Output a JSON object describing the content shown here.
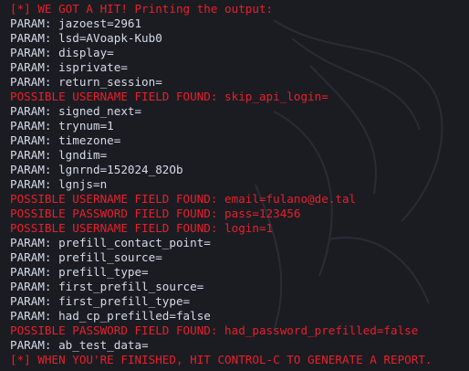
{
  "colors": {
    "background": "#1b1c22",
    "normal_text": "#d5dbe8",
    "alert_text": "#e8202a"
  },
  "terminal": {
    "lines": [
      {
        "kind": "status",
        "text": "[*] WE GOT A HIT! Printing the output:"
      },
      {
        "kind": "param",
        "text": "PARAM: jazoest=2961"
      },
      {
        "kind": "param",
        "text": "PARAM: lsd=AVoapk-Kub0"
      },
      {
        "kind": "param",
        "text": "PARAM: display="
      },
      {
        "kind": "param",
        "text": "PARAM: isprivate="
      },
      {
        "kind": "param",
        "text": "PARAM: return_session="
      },
      {
        "kind": "found",
        "text": "POSSIBLE USERNAME FIELD FOUND: skip_api_login="
      },
      {
        "kind": "param",
        "text": "PARAM: signed_next="
      },
      {
        "kind": "param",
        "text": "PARAM: trynum=1"
      },
      {
        "kind": "param",
        "text": "PARAM: timezone="
      },
      {
        "kind": "param",
        "text": "PARAM: lgndim="
      },
      {
        "kind": "param",
        "text": "PARAM: lgnrnd=152024_82Ob"
      },
      {
        "kind": "param",
        "text": "PARAM: lgnjs=n"
      },
      {
        "kind": "found",
        "text": "POSSIBLE USERNAME FIELD FOUND: email=fulano@de.tal"
      },
      {
        "kind": "found",
        "text": "POSSIBLE PASSWORD FIELD FOUND: pass=123456"
      },
      {
        "kind": "found",
        "text": "POSSIBLE USERNAME FIELD FOUND: login=1"
      },
      {
        "kind": "param",
        "text": "PARAM: prefill_contact_point="
      },
      {
        "kind": "param",
        "text": "PARAM: prefill_source="
      },
      {
        "kind": "param",
        "text": "PARAM: prefill_type="
      },
      {
        "kind": "param",
        "text": "PARAM: first_prefill_source="
      },
      {
        "kind": "param",
        "text": "PARAM: first_prefill_type="
      },
      {
        "kind": "param",
        "text": "PARAM: had_cp_prefilled=false"
      },
      {
        "kind": "found",
        "text": "POSSIBLE PASSWORD FIELD FOUND: had_password_prefilled=false"
      },
      {
        "kind": "param",
        "text": "PARAM: ab_test_data="
      },
      {
        "kind": "status",
        "text": "[*] WHEN YOU'RE FINISHED, HIT CONTROL-C TO GENERATE A REPORT."
      }
    ]
  }
}
